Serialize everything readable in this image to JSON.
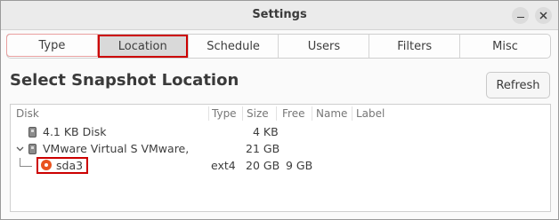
{
  "window": {
    "title": "Settings"
  },
  "tabs": [
    {
      "label": "Type"
    },
    {
      "label": "Location"
    },
    {
      "label": "Schedule"
    },
    {
      "label": "Users"
    },
    {
      "label": "Filters"
    },
    {
      "label": "Misc"
    }
  ],
  "main": {
    "heading": "Select Snapshot Location",
    "refresh_label": "Refresh"
  },
  "table": {
    "columns": [
      "Disk",
      "Type",
      "Size",
      "Free",
      "Name",
      "Label"
    ],
    "rows": [
      {
        "disk": "4.1 KB Disk",
        "type": "",
        "size": "4 KB",
        "free": "",
        "name": "",
        "label": ""
      },
      {
        "disk": "VMware Virtual S VMware,",
        "type": "",
        "size": "21 GB",
        "free": "",
        "name": "",
        "label": ""
      },
      {
        "disk": "sda3",
        "type": "ext4",
        "size": "20 GB",
        "free": "9 GB",
        "name": "",
        "label": ""
      }
    ]
  },
  "colors": {
    "accent": "#e95420",
    "highlight": "#cc0000"
  }
}
